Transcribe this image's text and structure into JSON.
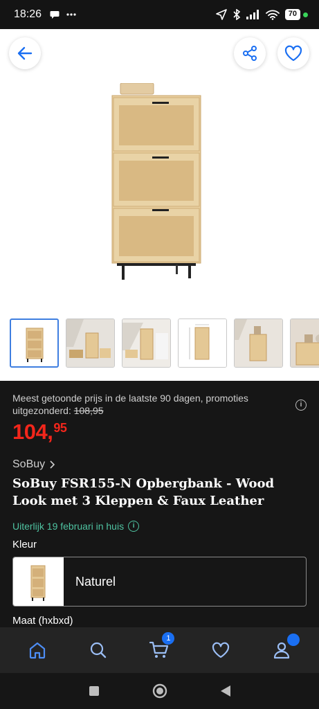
{
  "status_bar": {
    "time": "18:26",
    "battery": "70"
  },
  "colors": {
    "price": "#f2261b",
    "delivery": "#4fc3a1",
    "accent": "#1a6ff2",
    "background": "#161616"
  },
  "product": {
    "price_note": "Meest getoonde prijs in de laatste 90 dagen, promoties uitgezonderd:",
    "old_price": "108,95",
    "price_main": "104,",
    "price_cents": "95",
    "brand": "SoBuy",
    "title": "SoBuy FSR155-N Opbergbank - Wood Look met 3 Kleppen & Faux Leather",
    "delivery": "Uiterlijk 19 februari in huis",
    "color_label": "Kleur",
    "color_value": "Naturel",
    "size_label": "Maat (hxbxd)"
  },
  "nav": {
    "cart_count": "1"
  },
  "icons": [
    "back-arrow-icon",
    "share-icon",
    "heart-icon",
    "home-icon",
    "search-icon",
    "cart-icon",
    "user-icon",
    "info-icon",
    "chevron-right-icon"
  ]
}
